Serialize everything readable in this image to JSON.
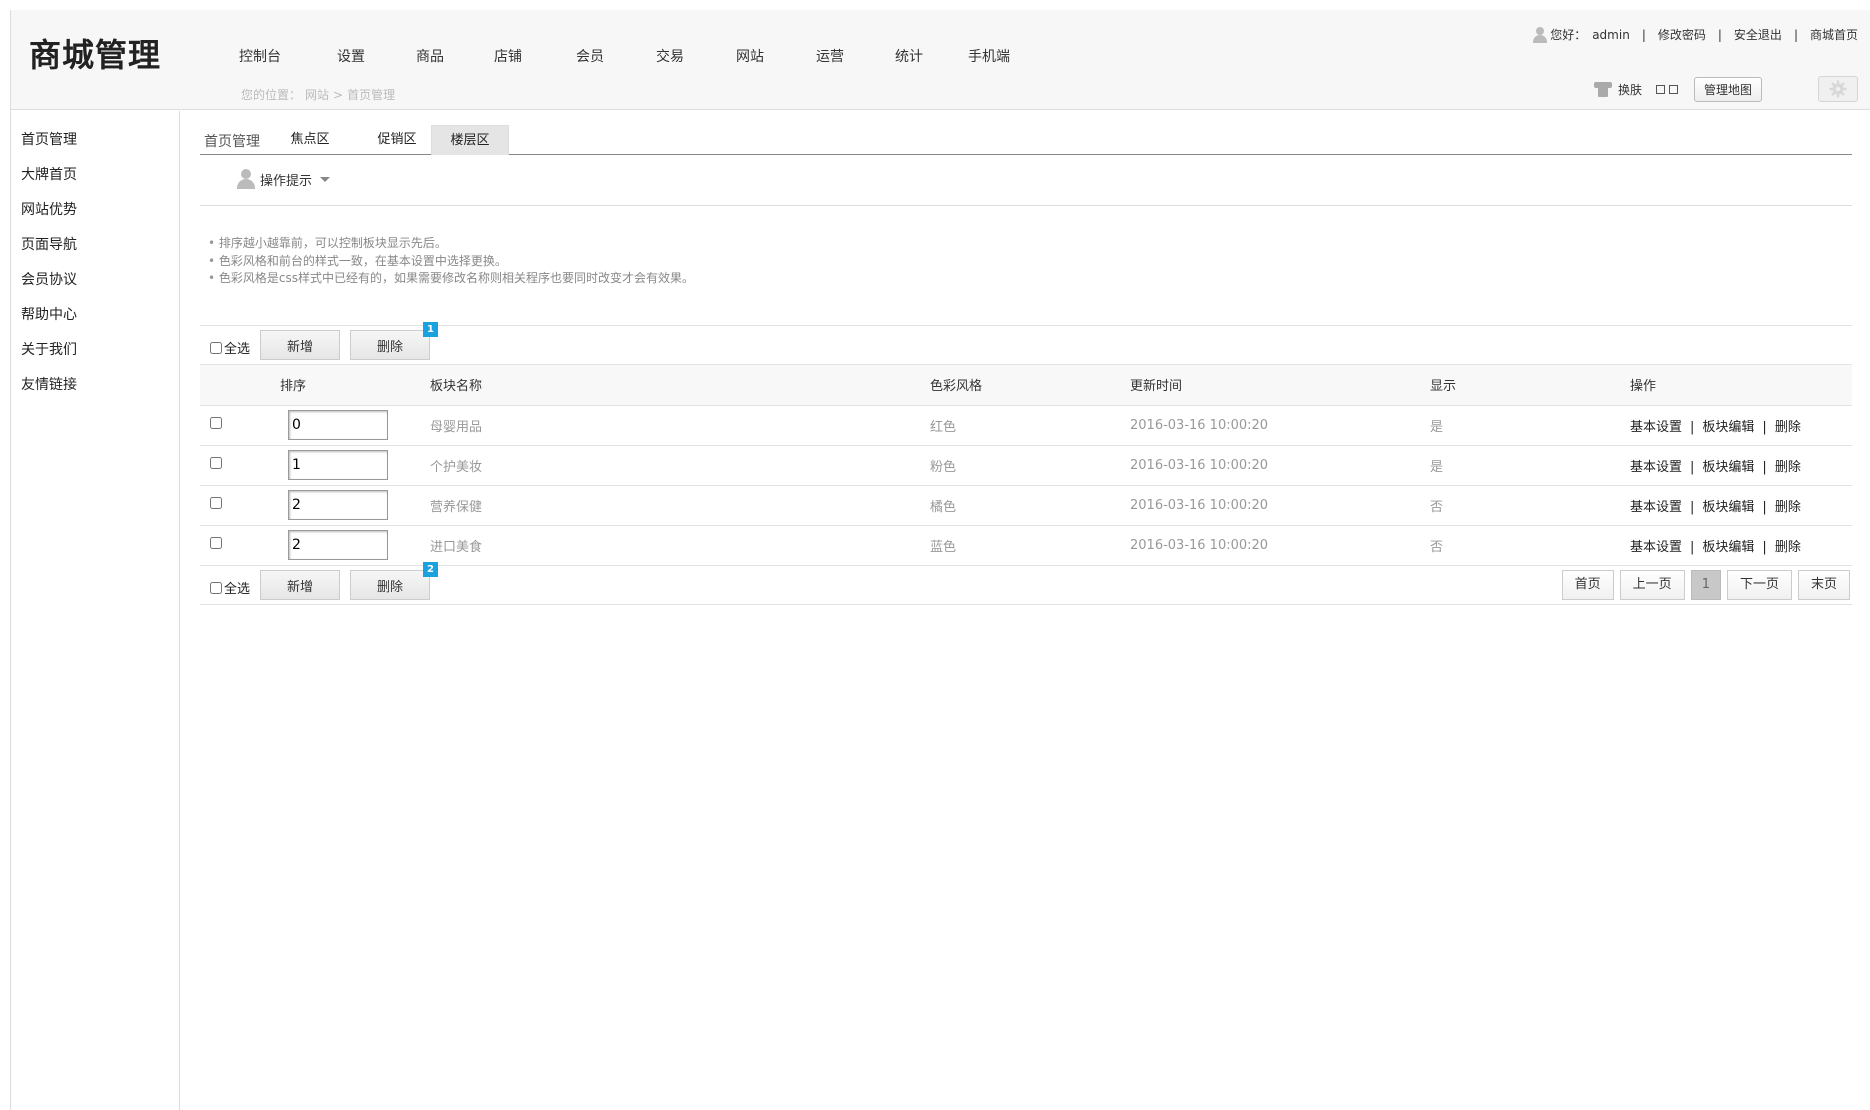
{
  "header": {
    "logo": "商城管理",
    "nav": [
      "控制台",
      "设置",
      "商品",
      "店铺",
      "会员",
      "交易",
      "网站",
      "运营",
      "统计",
      "手机端"
    ],
    "breadcrumb": {
      "prefix": "您的位置：",
      "items": [
        "网站",
        ">",
        "首页管理"
      ]
    },
    "top_links": {
      "greeting": "您好：",
      "user": "admin",
      "change_password": "修改密码",
      "logout": "安全退出",
      "store_home": "商城首页"
    },
    "tools": {
      "skin": "换肤",
      "site_map": "管理地图"
    }
  },
  "sidebar": {
    "items": [
      "首页管理",
      "大牌首页",
      "网站优势",
      "页面导航",
      "会员协议",
      "帮助中心",
      "关于我们",
      "友情链接"
    ]
  },
  "tabs": {
    "title": "首页管理",
    "items": [
      "焦点区",
      "促销区",
      "楼层区"
    ],
    "active": "楼层区"
  },
  "tips": {
    "heading": "操作提示",
    "lines": [
      "排序越小越靠前，可以控制板块显示先后。",
      "色彩风格和前台的样式一致，在基本设置中选择更换。",
      "色彩风格是css样式中已经有的，如果需要修改名称则相关程序也要同时改变才会有效果。"
    ]
  },
  "toolbar": {
    "select_all": "全选",
    "add": "新增",
    "delete": "删除",
    "badge_top": "1",
    "badge_bottom": "2"
  },
  "table": {
    "headers": [
      "排序",
      "板块名称",
      "色彩风格",
      "更新时间",
      "显示",
      "操作"
    ],
    "rows": [
      {
        "sort": "0",
        "name": "母婴用品",
        "color": "红色",
        "time": "2016-03-16 10:00:20",
        "show": "是"
      },
      {
        "sort": "1",
        "name": "个护美妆",
        "color": "粉色",
        "time": "2016-03-16 10:00:20",
        "show": "是"
      },
      {
        "sort": "2",
        "name": "营养保健",
        "color": "橘色",
        "time": "2016-03-16 10:00:20",
        "show": "否"
      },
      {
        "sort": "2",
        "name": "进口美食",
        "color": "蓝色",
        "time": "2016-03-16 10:00:20",
        "show": "否"
      }
    ],
    "ops": {
      "basic": "基本设置",
      "edit": "板块编辑",
      "delete": "删除",
      "sep": "|"
    }
  },
  "pager": {
    "first": "首页",
    "prev": "上一页",
    "current": "1",
    "next": "下一页",
    "last": "末页"
  },
  "colors": {
    "badge": "#1aa1e0",
    "header_bg": "#f7f7f7",
    "active_tab": "#e5e5e5"
  }
}
